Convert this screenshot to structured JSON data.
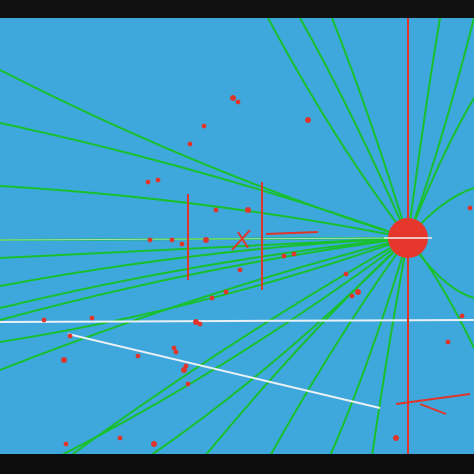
{
  "colors": {
    "field": "#3ea8dc",
    "ray": "#18c02f",
    "particle": "#e0352b",
    "sun": "#e6372d",
    "white_line": "#e9f0f6",
    "frame": "#0b0b0b"
  },
  "scene": {
    "origin_icon": "radiating-sun-icon",
    "ray_count": 26,
    "particle_count": 40
  },
  "status_bar": {
    "segments": [
      "",
      "",
      "",
      "",
      "",
      "",
      "",
      ""
    ]
  }
}
